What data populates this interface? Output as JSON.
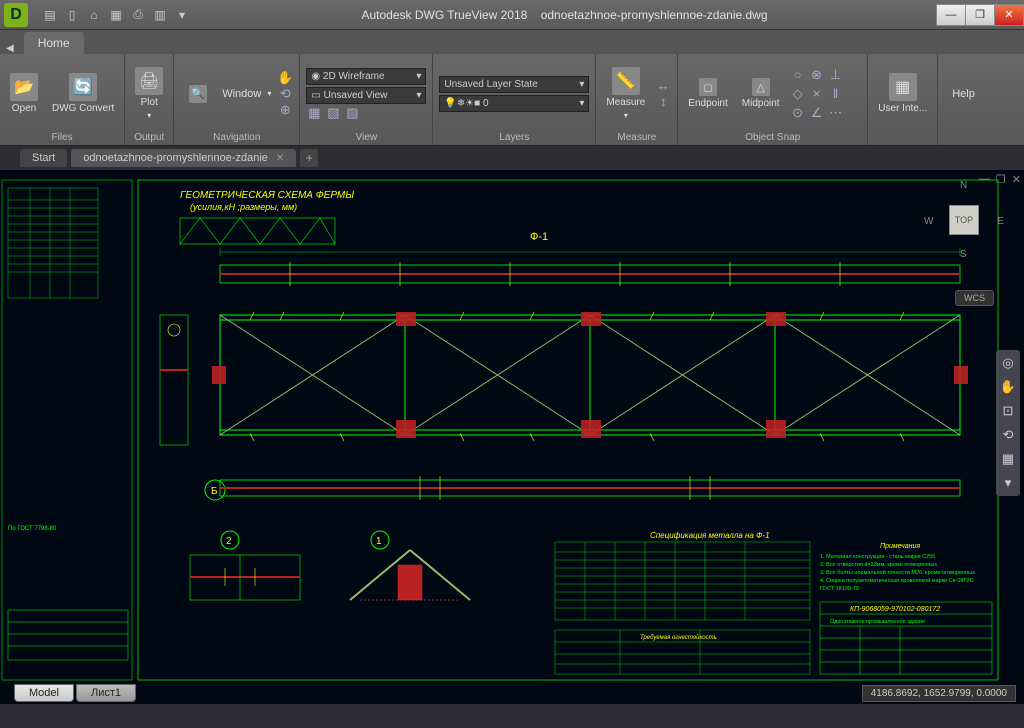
{
  "app": {
    "title": "Autodesk DWG TrueView 2018",
    "file": "odnoetazhnoe-promyshlennoe-zdanie.dwg",
    "logo_letter": "D"
  },
  "qat": [
    "▤",
    "▯",
    "⌂",
    "▦",
    "⎙",
    "▥",
    "▾"
  ],
  "winbtns": {
    "min": "—",
    "max": "❐",
    "close": "✕"
  },
  "ribbon": {
    "home_tab": "Home",
    "files": {
      "label": "Files",
      "open": "Open",
      "convert": "DWG Convert"
    },
    "output": {
      "label": "Output",
      "plot": "Plot"
    },
    "navigation": {
      "label": "Navigation",
      "window": "Window"
    },
    "view": {
      "label": "View",
      "style": "2D Wireframe",
      "saved": "Unsaved View"
    },
    "layers": {
      "label": "Layers",
      "state": "Unsaved Layer State",
      "current": "0"
    },
    "measure": {
      "label": "Measure",
      "measure": "Measure"
    },
    "osnap": {
      "label": "Object Snap",
      "endpoint": "Endpoint",
      "midpoint": "Midpoint"
    },
    "userint": {
      "label": "User Inte...",
      "help": "Help"
    }
  },
  "doctabs": {
    "start": "Start",
    "file": "odnoetazhnoe-promyshlennoe-zdanie"
  },
  "viewcube": {
    "top": "TOP",
    "n": "N",
    "s": "S",
    "e": "E",
    "w": "W",
    "wcs": "WCS"
  },
  "drawing": {
    "scheme_title": "ГЕОМЕТРИЧЕСКАЯ СХЕМА ФЕРМЫ",
    "scheme_sub": "(усилия,кН ;размеры, мм)",
    "label_f1": "Ф-1",
    "axis_b": "Б",
    "detail1": "1",
    "detail2": "2",
    "spec_title": "Спецификация металла на Ф-1",
    "notes_title": "Примечания",
    "note1": "1. Материал конструкции - сталь марки С255",
    "note2": "2. Все отверстия d=23мм, кроме оговоренных",
    "note3": "3. Все болты нормальной точности М20, кроме оговоренных",
    "note4": "4. Сварка полуавтоматическая проволокой марки Св-08Г2С",
    "note5": "ГОСТ 18130-79",
    "titleblock": "КП-9068059-970102-080172",
    "tb2": "Одноэтажное промышленное здание",
    "tb3": "Требуемая огнестойкость",
    "left_note": "По ГОСТ 7798-80"
  },
  "bottomtabs": {
    "model": "Model",
    "sheet": "Лист1"
  },
  "coords": "4186.8692, 1652.9799, 0.0000"
}
